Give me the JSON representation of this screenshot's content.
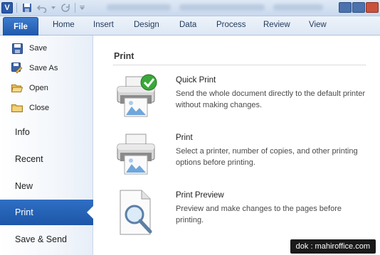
{
  "ribbon": {
    "file_label": "File",
    "tabs": [
      "Home",
      "Insert",
      "Design",
      "Data",
      "Process",
      "Review",
      "View"
    ]
  },
  "backstage": {
    "commands": [
      {
        "label": "Save",
        "icon": "save-icon"
      },
      {
        "label": "Save As",
        "icon": "save-as-icon"
      },
      {
        "label": "Open",
        "icon": "open-folder-icon"
      },
      {
        "label": "Close",
        "icon": "close-folder-icon"
      }
    ],
    "items": [
      "Info",
      "Recent",
      "New",
      "Print",
      "Save & Send"
    ],
    "selected": "Print"
  },
  "print": {
    "section_title": "Print",
    "options": [
      {
        "title": "Quick Print",
        "description": "Send the whole document directly to the default printer without making changes.",
        "icon": "quick-print-icon"
      },
      {
        "title": "Print",
        "description": "Select a printer, number of copies, and other printing options before printing.",
        "icon": "printer-icon"
      },
      {
        "title": "Print Preview",
        "description": "Preview and make changes to the pages before printing.",
        "icon": "print-preview-icon"
      }
    ]
  },
  "watermark": "dok : mahiroffice.com",
  "colors": {
    "accent": "#2a66b9",
    "ribbon_bg": "#dde7f4",
    "selected_nav": "#1f5aab"
  }
}
